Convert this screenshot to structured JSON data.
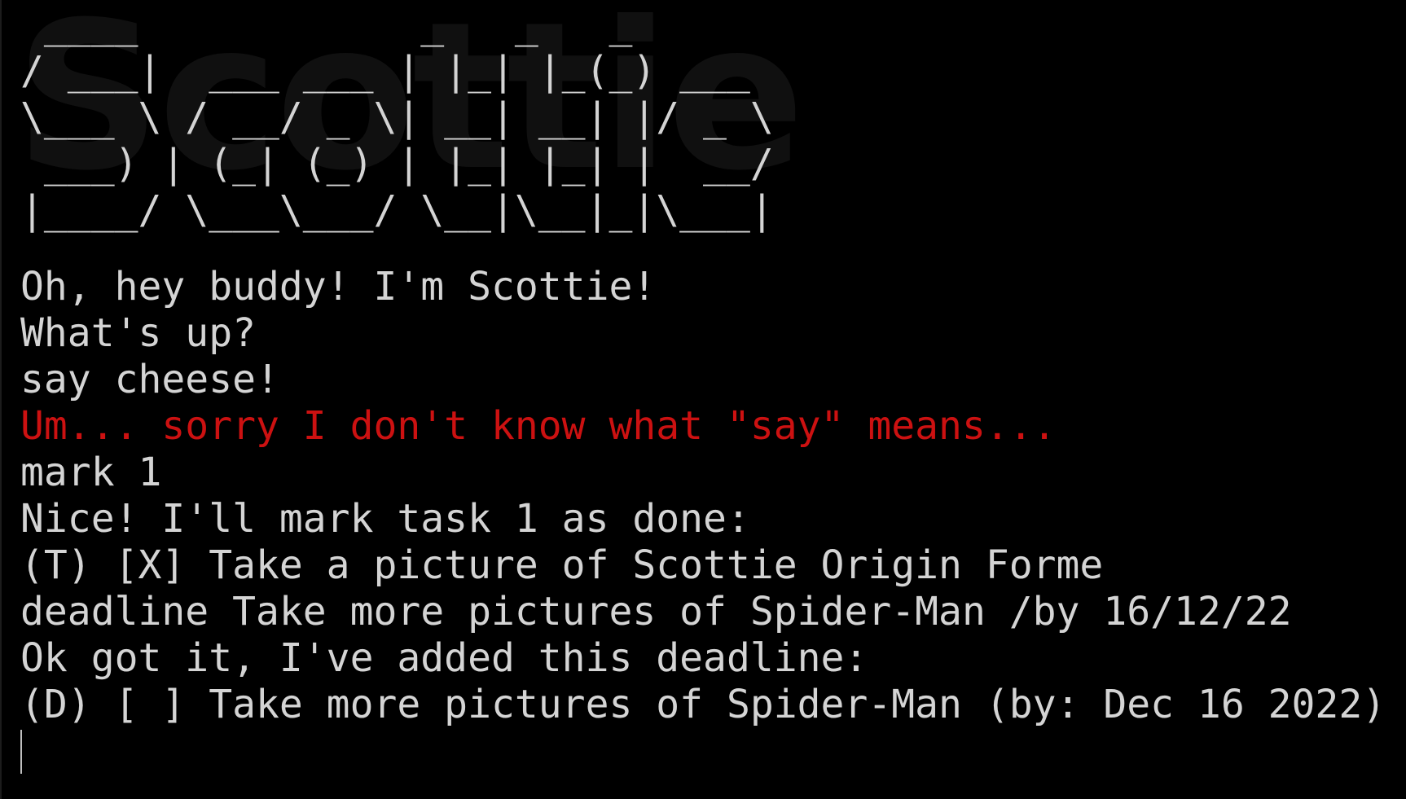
{
  "terminal": {
    "background_color": "#000000",
    "text_color": "#d4d4d4",
    "error_color": "#cc1111",
    "logo_lines": [
      " ____            _   _   _",
      "/ ___|  ___ ___ | |_| |_(_) ___",
      "\\___ \\ / __/ _ \\| __| __| |/ _ \\",
      " ___) | (_| (_) | |_| |_| |  __/",
      "|____/ \\___\\___/ \\__|\\__|_|\\___|"
    ],
    "logo_ghost_text": "Scottie",
    "lines": [
      {
        "text": "Oh, hey buddy! I'm Scottie!",
        "kind": "output"
      },
      {
        "text": "What's up?",
        "kind": "output"
      },
      {
        "text": "say cheese!",
        "kind": "input"
      },
      {
        "text": "Um... sorry I don't know what \"say\" means...",
        "kind": "error"
      },
      {
        "text": "mark 1",
        "kind": "input"
      },
      {
        "text": "Nice! I'll mark task 1 as done:",
        "kind": "output"
      },
      {
        "text": "(T) [X] Take a picture of Scottie Origin Forme",
        "kind": "output"
      },
      {
        "text": "deadline Take more pictures of Spider-Man /by 16/12/22",
        "kind": "input"
      },
      {
        "text": "Ok got it, I've added this deadline:",
        "kind": "output"
      },
      {
        "text": "(D) [ ] Take more pictures of Spider-Man (by: Dec 16 2022)",
        "kind": "output"
      }
    ],
    "input_value": ""
  }
}
